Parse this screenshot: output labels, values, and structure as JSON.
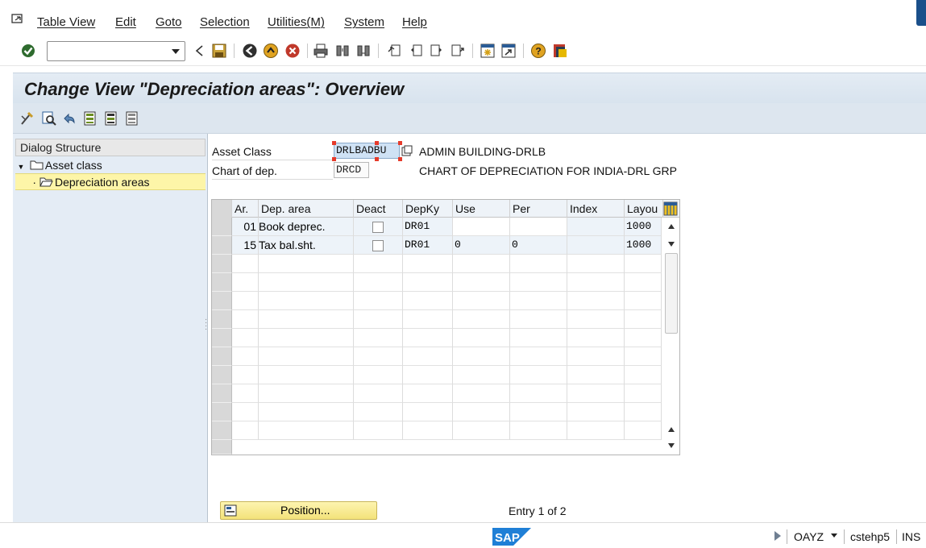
{
  "menu": {
    "items": [
      "Table View",
      "Edit",
      "Goto",
      "Selection",
      "Utilities(M)",
      "System",
      "Help"
    ]
  },
  "toolbar": {
    "command_value": "",
    "icons": [
      "enter-icon",
      "back-icon",
      "save-icon",
      "back-green-icon",
      "exit-icon",
      "cancel-icon",
      "print-icon",
      "find-icon",
      "find-next-icon",
      "first-page-icon",
      "previous-page-icon",
      "next-page-icon",
      "last-page-icon",
      "create-session-icon",
      "shortcut-icon",
      "help-icon",
      "layout-icon"
    ]
  },
  "page": {
    "title": "Change View \"Depreciation areas\": Overview"
  },
  "app_toolbar": {
    "icons": [
      "display-change-icon",
      "details-icon",
      "undo-icon",
      "select-all-icon",
      "select-block-icon",
      "deselect-all-icon"
    ]
  },
  "dialog_structure": {
    "header": "Dialog Structure",
    "nodes": [
      {
        "label": "Asset class",
        "expanded": true,
        "level": 0
      },
      {
        "label": "Depreciation areas",
        "selected": true,
        "level": 1
      }
    ]
  },
  "header_fields": {
    "asset_class_label": "Asset Class",
    "asset_class_value": "DRLBADBU",
    "asset_class_desc": "ADMIN BUILDING-DRLB",
    "chart_label": "Chart of dep.",
    "chart_value": "DRCD",
    "chart_desc": "CHART OF DEPRECIATION FOR INDIA-DRL GRP"
  },
  "table": {
    "columns": [
      "Ar.",
      "Dep. area",
      "Deact",
      "DepKy",
      "Use",
      "Per",
      "Index",
      "Layou"
    ],
    "rows": [
      {
        "ar": "01",
        "dep_area": "Book deprec.",
        "deact": false,
        "depky": "DR01",
        "use": "",
        "per": "",
        "index": "",
        "layout": "1000"
      },
      {
        "ar": "15",
        "dep_area": "Tax bal.sht.",
        "deact": false,
        "depky": "DR01",
        "use": "0",
        "per": "0",
        "index": "",
        "layout": "1000"
      }
    ]
  },
  "footer": {
    "position_label": "Position...",
    "entry_info": "Entry 1 of 2"
  },
  "status": {
    "logo": "SAP",
    "transaction": "OAYZ",
    "server": "cstehp5",
    "mode": "INS"
  },
  "colors": {
    "title_bg": "#dfe8f1",
    "selected_node": "#fdf5a8",
    "position_button": "#f6e88a",
    "input_highlight": "#cfe2f5"
  }
}
